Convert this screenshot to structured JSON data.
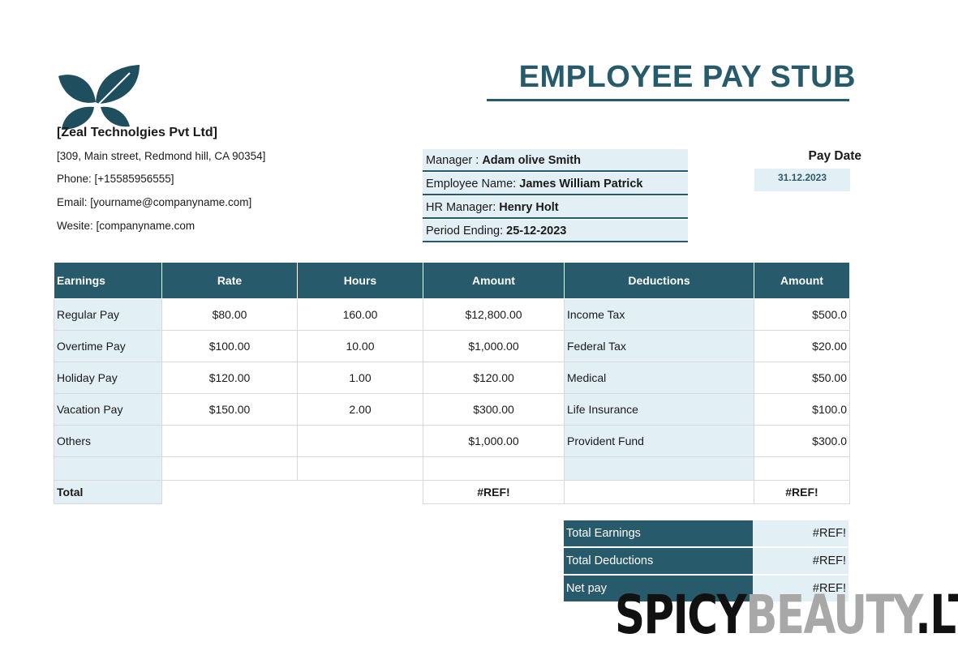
{
  "title": "EMPLOYEE PAY STUB",
  "company": {
    "name": "[Zeal Technolgies Pvt Ltd]",
    "address": "[309, Main street, Redmond hill, CA 90354]",
    "phone": "Phone: [+15585956555]",
    "email": "Email: [yourname@companyname.com]",
    "website": "Wesite: [companyname.com"
  },
  "info": {
    "manager_label": "Manager : ",
    "manager": "Adam olive Smith",
    "employee_label": "Employee Name: ",
    "employee": "James William Patrick",
    "hr_label": "HR Manager: ",
    "hr": "Henry Holt",
    "period_label": "Period Ending: ",
    "period": "25-12-2023"
  },
  "pay_date": {
    "label": "Pay Date",
    "value": "31.12.2023"
  },
  "table": {
    "headers": [
      "Earnings",
      "Rate",
      "Hours",
      "Amount",
      "Deductions",
      "Amount"
    ],
    "rows": [
      [
        "Regular Pay",
        "$80.00",
        "160.00",
        "$12,800.00",
        "Income Tax",
        "$500.0"
      ],
      [
        "Overtime Pay",
        "$100.00",
        "10.00",
        "$1,000.00",
        "Federal Tax",
        "$20.00"
      ],
      [
        "Holiday Pay",
        "$120.00",
        "1.00",
        "$120.00",
        "Medical",
        "$50.00"
      ],
      [
        "Vacation Pay",
        "$150.00",
        "2.00",
        "$300.00",
        "Life Insurance",
        "$100.0"
      ],
      [
        "Others",
        "",
        "",
        "$1,000.00",
        "Provident Fund",
        "$300.0"
      ],
      [
        "",
        "",
        "",
        "",
        "",
        ""
      ]
    ],
    "total_label": "Total",
    "total_amount": "#REF!",
    "total_deductions": "#REF!"
  },
  "summary": [
    {
      "label": "Total Earnings",
      "value": "#REF!"
    },
    {
      "label": "Total Deductions",
      "value": "#REF!"
    },
    {
      "label": "Net pay",
      "value": "#REF!"
    }
  ],
  "watermark": {
    "part1": "SPICY",
    "part2": "BEAUTY",
    "part3": ".LT"
  },
  "colors": {
    "accent": "#275a6a",
    "light_fill": "#e2eff5"
  }
}
